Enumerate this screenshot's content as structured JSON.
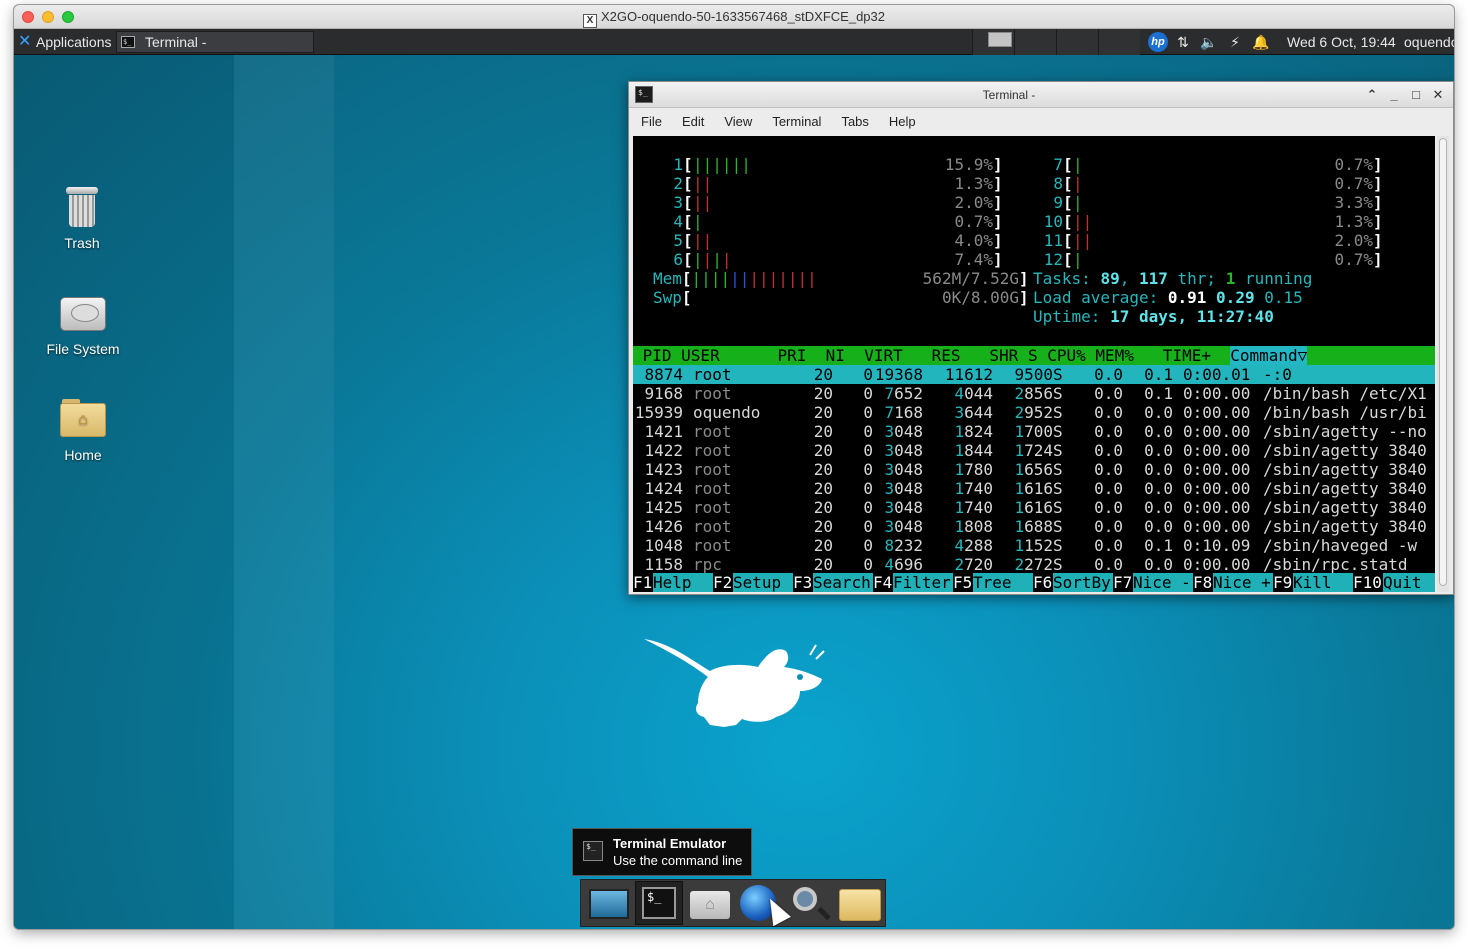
{
  "mac": {
    "title": "X2GO-oquendo-50-1633567468_stDXFCE_dp32",
    "title_glyph": "X"
  },
  "panel": {
    "applications_label": "Applications",
    "applications_arrow": "⠇",
    "task_label": "Terminal -",
    "clock": "Wed  6 Oct, 19:44",
    "user": "oquendo",
    "tray_icons": [
      "hp-icon",
      "network-icon",
      "volume-icon",
      "power-icon",
      "notification-icon"
    ]
  },
  "desktop_icons": [
    {
      "label": "Trash",
      "icon": "trash-icon"
    },
    {
      "label": "File System",
      "icon": "drive-icon"
    },
    {
      "label": "Home",
      "icon": "home-folder-icon"
    }
  ],
  "terminal": {
    "title": "Terminal -",
    "menu": [
      "File",
      "Edit",
      "View",
      "Terminal",
      "Tabs",
      "Help"
    ],
    "cpus_left": [
      {
        "n": "1",
        "pct": "15.9%"
      },
      {
        "n": "2",
        "pct": "1.3%"
      },
      {
        "n": "3",
        "pct": "2.0%"
      },
      {
        "n": "4",
        "pct": "0.7%"
      },
      {
        "n": "5",
        "pct": "4.0%"
      },
      {
        "n": "6",
        "pct": "7.4%"
      }
    ],
    "cpus_right": [
      {
        "n": "7",
        "pct": "0.7%"
      },
      {
        "n": "8",
        "pct": "0.7%"
      },
      {
        "n": "9",
        "pct": "3.3%"
      },
      {
        "n": "10",
        "pct": "1.3%"
      },
      {
        "n": "11",
        "pct": "2.0%"
      },
      {
        "n": "12",
        "pct": "0.7%"
      }
    ],
    "mem_label": "Mem",
    "mem_value": "562M/7.52G",
    "swp_label": "Swp",
    "swp_value": "0K/8.00G",
    "tasks_label": "Tasks:",
    "tasks_count": "89",
    "threads": "117",
    "thr_label": "thr;",
    "running": "1",
    "running_label": "running",
    "load_label": "Load average:",
    "load_1": "0.91",
    "load_5": "0.29",
    "load_15": "0.15",
    "uptime_label": "Uptime:",
    "uptime_value": "17 days, 11:27:40",
    "header": " PID USER      PRI  NI  VIRT   RES   SHR S CPU% MEM%   TIME+  ",
    "header_sort": "Command▽",
    "processes": [
      {
        "pid": " 8874",
        "user": "root",
        "pri": "20",
        "ni": "0",
        "virt": "19368",
        "res": "11612",
        "shr": " 9500",
        "s": "S",
        "cpu": "0.0",
        "mem": "0.1",
        "time": "0:00.01",
        "cmd": "-:0"
      },
      {
        "pid": " 9168",
        "user": "root",
        "pri": "20",
        "ni": "0",
        "virt": " 7652",
        "res": " 4044",
        "shr": " 2856",
        "s": "S",
        "cpu": "0.0",
        "mem": "0.1",
        "time": "0:00.00",
        "cmd": "/bin/bash /etc/X1"
      },
      {
        "pid": "15939",
        "user": "oquendo",
        "pri": "20",
        "ni": "0",
        "virt": " 7168",
        "res": " 3644",
        "shr": " 2952",
        "s": "S",
        "cpu": "0.0",
        "mem": "0.0",
        "time": "0:00.00",
        "cmd": "/bin/bash /usr/bi"
      },
      {
        "pid": " 1421",
        "user": "root",
        "pri": "20",
        "ni": "0",
        "virt": " 3048",
        "res": " 1824",
        "shr": " 1700",
        "s": "S",
        "cpu": "0.0",
        "mem": "0.0",
        "time": "0:00.00",
        "cmd": "/sbin/agetty --no"
      },
      {
        "pid": " 1422",
        "user": "root",
        "pri": "20",
        "ni": "0",
        "virt": " 3048",
        "res": " 1844",
        "shr": " 1724",
        "s": "S",
        "cpu": "0.0",
        "mem": "0.0",
        "time": "0:00.00",
        "cmd": "/sbin/agetty 3840"
      },
      {
        "pid": " 1423",
        "user": "root",
        "pri": "20",
        "ni": "0",
        "virt": " 3048",
        "res": " 1780",
        "shr": " 1656",
        "s": "S",
        "cpu": "0.0",
        "mem": "0.0",
        "time": "0:00.00",
        "cmd": "/sbin/agetty 3840"
      },
      {
        "pid": " 1424",
        "user": "root",
        "pri": "20",
        "ni": "0",
        "virt": " 3048",
        "res": " 1740",
        "shr": " 1616",
        "s": "S",
        "cpu": "0.0",
        "mem": "0.0",
        "time": "0:00.00",
        "cmd": "/sbin/agetty 3840"
      },
      {
        "pid": " 1425",
        "user": "root",
        "pri": "20",
        "ni": "0",
        "virt": " 3048",
        "res": " 1740",
        "shr": " 1616",
        "s": "S",
        "cpu": "0.0",
        "mem": "0.0",
        "time": "0:00.00",
        "cmd": "/sbin/agetty 3840"
      },
      {
        "pid": " 1426",
        "user": "root",
        "pri": "20",
        "ni": "0",
        "virt": " 3048",
        "res": " 1808",
        "shr": " 1688",
        "s": "S",
        "cpu": "0.0",
        "mem": "0.0",
        "time": "0:00.00",
        "cmd": "/sbin/agetty 3840"
      },
      {
        "pid": " 1048",
        "user": "root",
        "pri": "20",
        "ni": "0",
        "virt": " 8232",
        "res": " 4288",
        "shr": " 1152",
        "s": "S",
        "cpu": "0.0",
        "mem": "0.1",
        "time": "0:10.09",
        "cmd": "/sbin/haveged -w"
      },
      {
        "pid": " 1158",
        "user": "rpc",
        "pri": "20",
        "ni": "0",
        "virt": " 4696",
        "res": " 2720",
        "shr": " 2272",
        "s": "S",
        "cpu": "0.0",
        "mem": "0.0",
        "time": "0:00.00",
        "cmd": "/sbin/rpc.statd"
      }
    ],
    "fkeys": [
      {
        "key": "F1",
        "label": "Help  "
      },
      {
        "key": "F2",
        "label": "Setup "
      },
      {
        "key": "F3",
        "label": "Search"
      },
      {
        "key": "F4",
        "label": "Filter"
      },
      {
        "key": "F5",
        "label": "Tree  "
      },
      {
        "key": "F6",
        "label": "SortBy"
      },
      {
        "key": "F7",
        "label": "Nice -"
      },
      {
        "key": "F8",
        "label": "Nice +"
      },
      {
        "key": "F9",
        "label": "Kill  "
      },
      {
        "key": "F10",
        "label": "Quit  "
      }
    ]
  },
  "tooltip": {
    "title": "Terminal Emulator",
    "subtitle": "Use the command line"
  },
  "dock": {
    "items": [
      "show-desktop-icon",
      "terminal-icon",
      "home-folder-icon",
      "web-browser-icon",
      "search-icon",
      "file-manager-icon"
    ],
    "terminal_prompt": "$_"
  },
  "colors": {
    "desktop": "#0b8fb8",
    "htop_header": "#16b11a",
    "htop_selection": "#23b5bd",
    "panel": "#2a2c2e"
  }
}
